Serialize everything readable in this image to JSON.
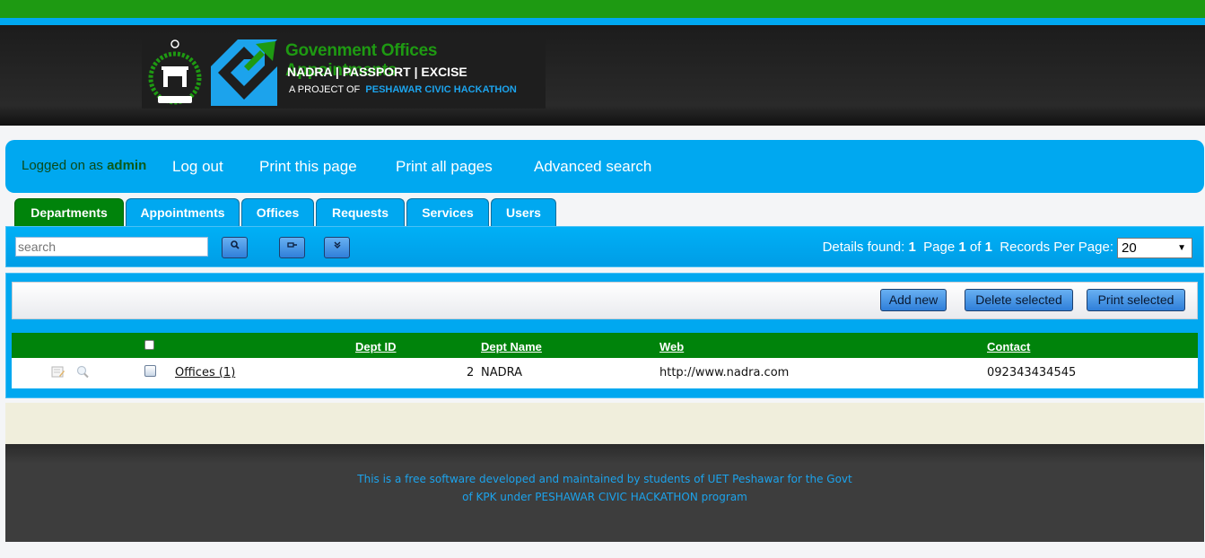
{
  "brand": {
    "title": "Govenment Offices Appointments",
    "subtitle": "NADRA | PASSPORT | EXCISE",
    "project_prefix": "A PROJECT OF",
    "project_name": "PESHAWAR CIVIC HACKATHON"
  },
  "nav": {
    "logged_prefix": "Logged on as",
    "username": "admin",
    "links": [
      "Log out",
      "Print this page",
      "Print all pages",
      "Advanced search"
    ]
  },
  "tabs": [
    {
      "label": "Departments",
      "active": true
    },
    {
      "label": "Appointments",
      "active": false
    },
    {
      "label": "Offices",
      "active": false
    },
    {
      "label": "Requests",
      "active": false
    },
    {
      "label": "Services",
      "active": false
    },
    {
      "label": "Users",
      "active": false
    }
  ],
  "toolbar": {
    "search_placeholder": "search",
    "details_label": "Details found:",
    "details_count": "1",
    "page_label": "Page",
    "page_current": "1",
    "page_of": "of",
    "page_total": "1",
    "records_label": "Records Per Page:",
    "records_value": "20"
  },
  "actions": {
    "add": "Add new",
    "delete": "Delete selected",
    "print": "Print selected"
  },
  "grid": {
    "columns": [
      "Dept ID",
      "Dept Name",
      "Web",
      "Contact"
    ],
    "rows": [
      {
        "offices": "Offices (1)",
        "dept_id": "2",
        "dept_name": "NADRA",
        "web": "http://www.nadra.com",
        "contact": "092343434545"
      }
    ]
  },
  "footer": {
    "line1": "This is a free software developed and maintained by students of UET Peshawar for the Govt",
    "line2": "of KPK under PESHAWAR CIVIC HACKATHON program"
  },
  "colors": {
    "green": "#00830b",
    "blue": "#00a8f0",
    "dark": "#1e1e1e"
  }
}
